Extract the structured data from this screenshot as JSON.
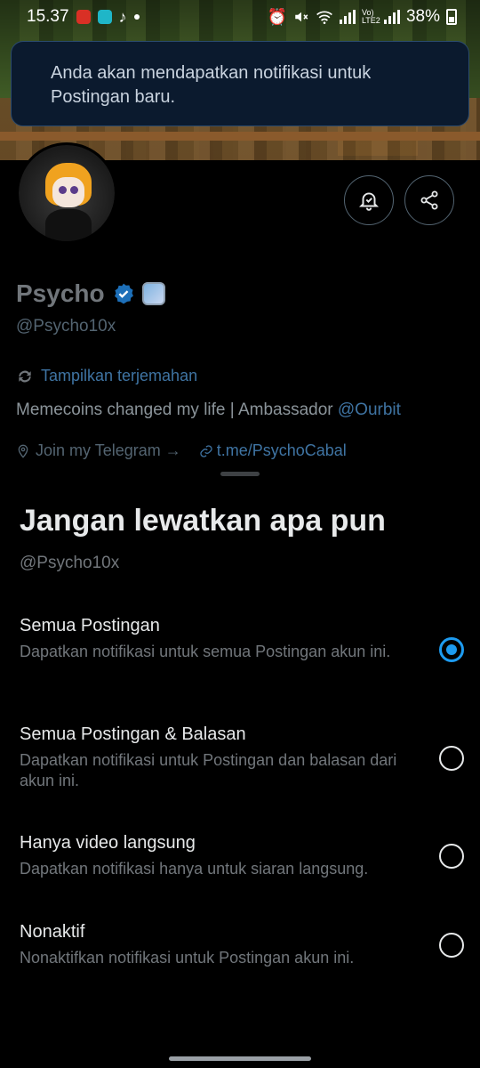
{
  "status_bar": {
    "time": "15.37",
    "battery": "38%",
    "network_label": "Vo) LTE2"
  },
  "toast": {
    "message": "Anda akan mendapatkan notifikasi untuk Postingan baru."
  },
  "profile": {
    "name": "Psycho",
    "handle": "@Psycho10x",
    "translate_label": "Tampilkan terjemahan",
    "bio_text": "Memecoins changed my life | Ambassador ",
    "bio_mention": "@Ourbit",
    "location": "Join my Telegram →",
    "url": "t.me/PsychoCabal"
  },
  "sheet": {
    "title": "Jangan lewatkan apa pun",
    "handle": "@Psycho10x",
    "options": [
      {
        "title": "Semua Postingan",
        "desc": "Dapatkan notifikasi untuk semua Postingan akun ini.",
        "selected": true
      },
      {
        "title": "Semua Postingan & Balasan",
        "desc": "Dapatkan notifikasi untuk Postingan dan balasan dari akun ini.",
        "selected": false
      },
      {
        "title": "Hanya video langsung",
        "desc": "Dapatkan notifikasi hanya untuk siaran langsung.",
        "selected": false
      },
      {
        "title": "Nonaktif",
        "desc": "Nonaktifkan notifikasi untuk Postingan akun ini.",
        "selected": false
      }
    ]
  },
  "colors": {
    "accent": "#1d9bf0",
    "link": "#3f74a3",
    "toast_bg": "#0b1a2e"
  },
  "icons": [
    "alarm-icon",
    "mute-icon",
    "wifi-icon",
    "signal-icon",
    "battery-icon",
    "bell-check-icon",
    "share-icon",
    "verified-badge-icon",
    "translate-icon",
    "location-icon",
    "link-icon"
  ]
}
